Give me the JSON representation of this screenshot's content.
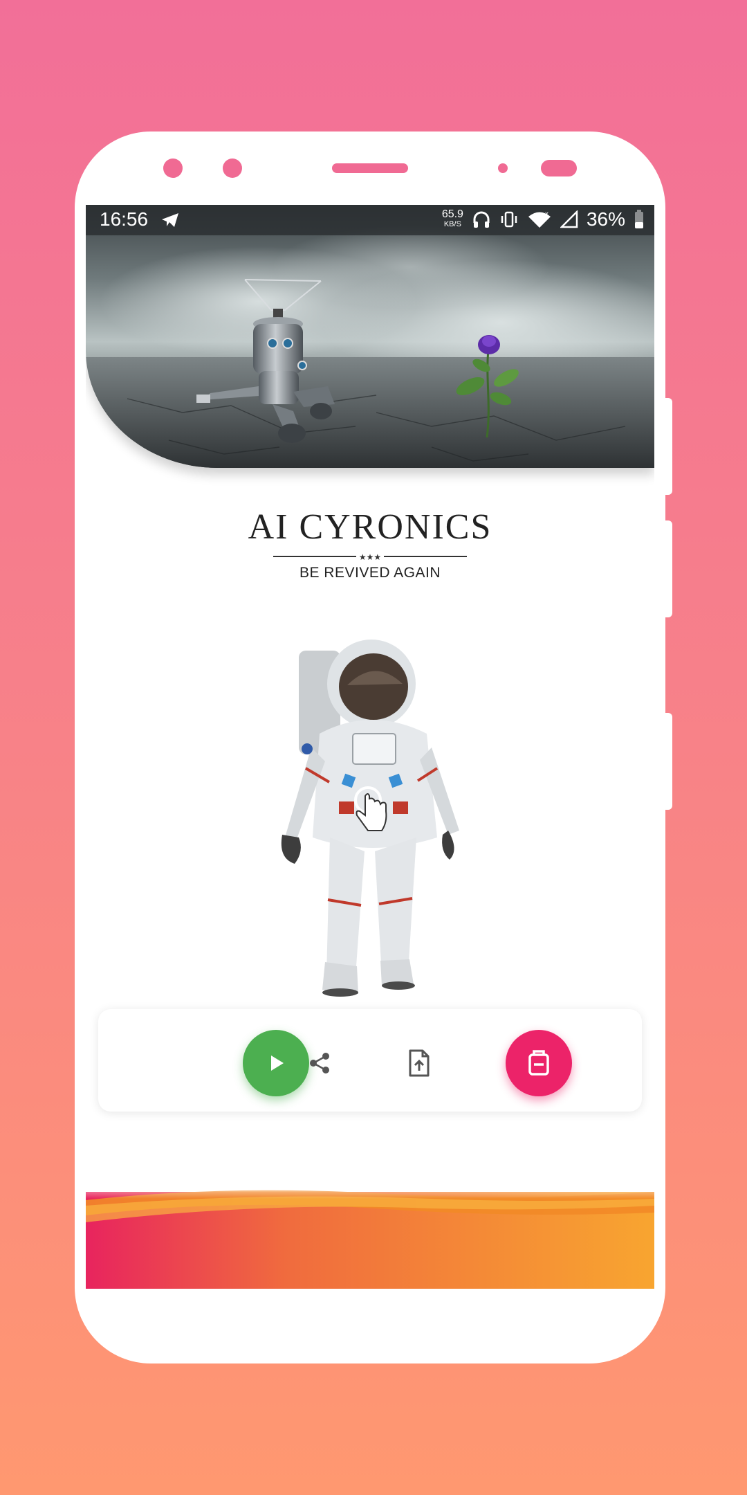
{
  "status_bar": {
    "time": "16:56",
    "speed_value": "65.9",
    "speed_unit": "KB/S",
    "battery": "36%"
  },
  "app": {
    "title": "AI CYRONICS",
    "tagline": "BE REVIVED AGAIN"
  },
  "toolbar": {
    "play_icon": "play-icon",
    "share_icon": "share-icon",
    "upload_icon": "file-upload-icon",
    "pink_icon": "exit-icon"
  },
  "colors": {
    "background_top": "#f26f98",
    "background_bottom": "#ff9870",
    "play_button": "#4caf50",
    "accent_button": "#ec2369"
  }
}
